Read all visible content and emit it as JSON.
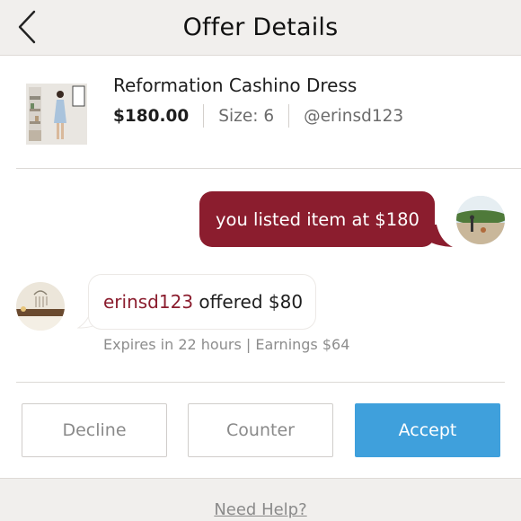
{
  "header": {
    "title": "Offer Details",
    "back_icon": "chevron-left-icon"
  },
  "product": {
    "name": "Reformation Cashino Dress",
    "price": "$180.00",
    "size": "Size: 6",
    "seller": "@erinsd123",
    "thumbnail": "product-photo"
  },
  "messages": {
    "mine": {
      "text": "you listed item at $180"
    },
    "theirs": {
      "username": "erinsd123",
      "text": " offered $80"
    },
    "expires": "Expires in 22 hours | Earnings $64"
  },
  "actions": {
    "decline": "Decline",
    "counter": "Counter",
    "accept": "Accept"
  },
  "footer": {
    "help": "Need Help?"
  },
  "colors": {
    "accent_maroon": "#8b1d2e",
    "accept_blue": "#3fa0dc",
    "header_bg": "#f1efed"
  }
}
